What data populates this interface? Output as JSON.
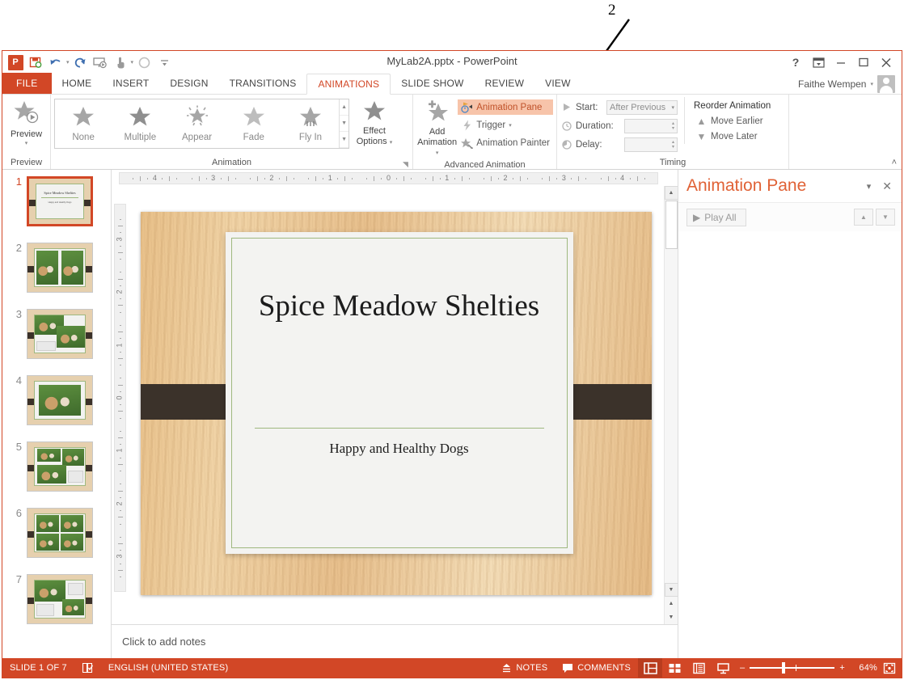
{
  "callout": {
    "number": "2"
  },
  "titlebar": {
    "document_title": "MyLab2A.pptx - PowerPoint",
    "qat": [
      {
        "name": "powerpoint-logo",
        "glyph": "P"
      },
      {
        "name": "save-icon",
        "glyph": "⬚"
      },
      {
        "name": "undo-icon",
        "glyph": "↶"
      },
      {
        "name": "redo-icon",
        "glyph": "↻"
      },
      {
        "name": "start-from-beginning-icon",
        "glyph": "▷"
      },
      {
        "name": "touch-mode-icon",
        "glyph": "☝"
      },
      {
        "name": "record-icon",
        "glyph": "◯"
      },
      {
        "name": "customize-qat-icon",
        "glyph": "≡"
      }
    ],
    "window_controls": [
      {
        "name": "help-button",
        "glyph": "?"
      },
      {
        "name": "ribbon-display-options-button",
        "glyph": "⬒"
      },
      {
        "name": "minimize-button",
        "glyph": "–"
      },
      {
        "name": "maximize-button",
        "glyph": "☐"
      },
      {
        "name": "close-button",
        "glyph": "✕"
      }
    ],
    "user_name": "Faithe Wempen"
  },
  "tabs": [
    {
      "label": "FILE",
      "active": false,
      "file": true
    },
    {
      "label": "HOME",
      "active": false
    },
    {
      "label": "INSERT",
      "active": false
    },
    {
      "label": "DESIGN",
      "active": false
    },
    {
      "label": "TRANSITIONS",
      "active": false
    },
    {
      "label": "ANIMATIONS",
      "active": true
    },
    {
      "label": "SLIDE SHOW",
      "active": false
    },
    {
      "label": "REVIEW",
      "active": false
    },
    {
      "label": "VIEW",
      "active": false
    }
  ],
  "ribbon": {
    "preview_group": {
      "label": "Preview",
      "button_label": "Preview"
    },
    "animation_group": {
      "label": "Animation",
      "items": [
        {
          "label": "None",
          "icon": "star-icon"
        },
        {
          "label": "Multiple",
          "icon": "star-icon"
        },
        {
          "label": "Appear",
          "icon": "sparkle-star-icon"
        },
        {
          "label": "Fade",
          "icon": "star-icon"
        },
        {
          "label": "Fly In",
          "icon": "fly-in-star-icon"
        }
      ],
      "effect_options_label": "Effect\nOptions"
    },
    "advanced_group": {
      "label": "Advanced Animation",
      "add_animation_label": "Add\nAnimation",
      "buttons": [
        {
          "label": "Animation Pane",
          "icon": "animation-pane-icon",
          "highlighted": true
        },
        {
          "label": "Trigger",
          "icon": "lightning-icon",
          "highlighted": false
        },
        {
          "label": "Animation Painter",
          "icon": "animation-painter-icon",
          "highlighted": false
        }
      ]
    },
    "timing_group": {
      "label": "Timing",
      "start_label": "Start:",
      "start_value": "After Previous",
      "duration_label": "Duration:",
      "duration_value": "",
      "delay_label": "Delay:",
      "delay_value": "",
      "reorder_title": "Reorder Animation",
      "move_earlier_label": "Move Earlier",
      "move_later_label": "Move Later"
    }
  },
  "thumbnails": {
    "slides": [
      {
        "number": "1",
        "selected": true,
        "kind": "title"
      },
      {
        "number": "2",
        "selected": false,
        "kind": "two-photo"
      },
      {
        "number": "3",
        "selected": false,
        "kind": "three-photo"
      },
      {
        "number": "4",
        "selected": false,
        "kind": "one-photo"
      },
      {
        "number": "5",
        "selected": false,
        "kind": "three-photo-b"
      },
      {
        "number": "6",
        "selected": false,
        "kind": "four-photo"
      },
      {
        "number": "7",
        "selected": false,
        "kind": "two-photo-b"
      }
    ]
  },
  "ruler": {
    "horizontal": [
      "4",
      "3",
      "2",
      "1",
      "0",
      "1",
      "2",
      "3",
      "4"
    ],
    "vertical": [
      "3",
      "2",
      "1",
      "0",
      "1",
      "2",
      "3"
    ]
  },
  "slide": {
    "title": "Spice Meadow Shelties",
    "subtitle": "Happy and Healthy Dogs"
  },
  "notes": {
    "placeholder": "Click to add notes"
  },
  "animation_pane": {
    "title": "Animation Pane",
    "play_all_label": "Play All",
    "collapse_icon": "chevron-down-icon",
    "close_icon": "close-icon",
    "move_up_icon": "triangle-up-icon",
    "move_down_icon": "triangle-down-icon"
  },
  "statusbar": {
    "slide_indicator": "SLIDE 1 OF 7",
    "language": "ENGLISH (UNITED STATES)",
    "notes_label": "NOTES",
    "comments_label": "COMMENTS",
    "views": [
      {
        "name": "normal-view-button",
        "glyph": "▤",
        "active": true
      },
      {
        "name": "slide-sorter-view-button",
        "glyph": "∷",
        "active": false
      },
      {
        "name": "reading-view-button",
        "glyph": "▥",
        "active": false
      },
      {
        "name": "slide-show-button",
        "glyph": "☰",
        "active": false
      }
    ],
    "zoom_out": "–",
    "zoom_in": "+",
    "zoom_level": "64%",
    "fit_icon": "fit-slide-icon"
  },
  "colors": {
    "accent": "#d24726",
    "highlight": "#f7c4aa",
    "pane_title": "#e06236"
  }
}
